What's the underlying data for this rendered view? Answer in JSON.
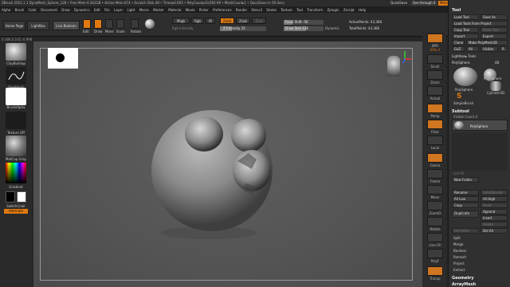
{
  "titlebar": {
    "text": "ZBrush 2021.1.1    DynaMesh_Sphere_128    • Free Mem 6.341GB • Active Mem 674 • Scratch Disk 49 • Timer▸0.003 • PolyCount▸43,692 KP • MeshCount▸1 • QuickSave In 59 Secs",
    "quicksave": "QuickSave",
    "see_through": "See-through",
    "see_through_value": "0",
    "menus_btn": "Menus",
    "script": "DefaultZScript"
  },
  "menubar": [
    "Alpha",
    "Brush",
    "Color",
    "Document",
    "Draw",
    "Dynamics",
    "Edit",
    "File",
    "Layer",
    "Light",
    "Macro",
    "Marker",
    "Material",
    "Movie",
    "Picker",
    "Preferences",
    "Render",
    "Stencil",
    "Stroke",
    "Texture",
    "Tool",
    "Transform",
    "Zplugin",
    "Zscript",
    "Help"
  ],
  "shelf": {
    "home_page": "Home Page",
    "lightbox": "LightBox",
    "live_boolean": "Live Boolean",
    "edit": "Edit",
    "draw": "Draw",
    "move": "Move",
    "scale": "Scale",
    "rotate": "Rotate",
    "mrgb": "Mrgb",
    "rgb": "Rgb",
    "m": "M",
    "rgb_intensity": "Rgb Intensity",
    "zadd": "Zadd",
    "zsub": "Zsub",
    "zcut": "Zcut",
    "z_intensity_label": "Z Intensity",
    "z_intensity_value": "25",
    "z_intensity_fraction": 0.25,
    "focal_shift_label": "Focal Shift",
    "focal_shift_value": "-56",
    "focal_shift_fraction": 0.22,
    "draw_size_label": "Draw Size",
    "draw_size_value": "128",
    "draw_size_fraction": 0.55,
    "dynamic": "Dynamic",
    "active_points": "ActivePoints: 43,368",
    "total_points": "TotalPoints: 43,368"
  },
  "coords": "0.386,0.165,-0.998",
  "lefttray": {
    "brush_label": "ClayBuildup",
    "stroke_label": "FreeHand",
    "alpha_label": "BrushAlpha",
    "texture_label": "Texture Off",
    "material_label": "MatCap Gray",
    "gradient_label": "Gradient",
    "switch_label": "SwitchColor",
    "alternate_label": "Alternate"
  },
  "righticons": [
    "BPR",
    "SPix 3",
    "Scroll",
    "Zoom",
    "Actual",
    "AAHalf",
    "Persp",
    "Floor",
    "Local",
    "Gizmo",
    "Frame",
    "Move",
    "ZoomD",
    "Rotate",
    "Line Fill",
    "PolyF",
    "Transp",
    "Ghost",
    "Solo",
    "Xpose"
  ],
  "rightpanel": {
    "title": "Tool",
    "load_tool": "Load Tool",
    "save_as": "Save As",
    "load_from_project": "Load Tools From Project",
    "copy_tool": "Copy Tool",
    "paste_tool": "Paste Tool",
    "import": "Import",
    "export": "Export",
    "clone": "Clone",
    "make_polymesh": "Make PolyMesh3D",
    "goz": "GoZ",
    "all": "All",
    "visible": "Visible",
    "r": "R",
    "lightbox_tools": "Lightbox▸ Tools",
    "polysphere_label": "PolySphere.",
    "polysphere_count": "48",
    "thumb1": "PolySphere",
    "thumb2": "PolySphere",
    "thumb3": "Cylinder3D",
    "thumb4": "SimpleBrush",
    "subtool": "Subtool",
    "visible_count": "Visible Count 4",
    "subtool_item": "PolySphere",
    "list_all": "List All",
    "new_folder": "New Folder",
    "rename": "Rename",
    "autoreorder": "AutoReorder",
    "all_low": "All Low",
    "all_high": "All High",
    "copy": "Copy",
    "paste": "Paste",
    "duplicate": "Duplicate",
    "append": "Append",
    "insert": "Insert",
    "delete": "Delete",
    "del_other": "Del Other",
    "del_all": "Del All",
    "split": "Split",
    "merge": "Merge",
    "boolean": "Boolean",
    "remesh": "Remesh",
    "project": "Project",
    "extract": "Extract",
    "geometry": "Geometry",
    "arraymesh": "ArrayMesh"
  },
  "colors": {
    "accent": "#e07a10",
    "canvas": "#585858"
  }
}
